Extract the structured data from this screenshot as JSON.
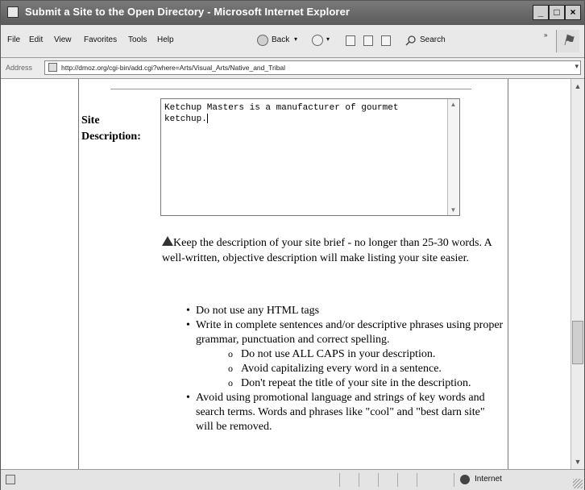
{
  "window": {
    "title": "Submit a Site to the Open Directory - Microsoft Internet Explorer",
    "controls": {
      "minimize": "_",
      "maximize": "□",
      "close": "×"
    }
  },
  "menu": [
    "File",
    "Edit",
    "View",
    "Favorites",
    "Tools",
    "Help"
  ],
  "toolbar": {
    "back_label": "Back",
    "search_label": "Search"
  },
  "address": {
    "label": "Address",
    "url": "http://dmoz.org/cgi-bin/add.cgi?where=Arts/Visual_Arts/Native_and_Tribal"
  },
  "form": {
    "description_label_line1": "Site",
    "description_label_line2": "Description:",
    "description_value": "Ketchup Masters is a manufacturer of gourmet ketchup."
  },
  "guidelines": {
    "intro": "Keep the description of your site brief - no longer than 25-30 words.  A well-written, objective description will make listing your site easier.",
    "tips": [
      "Do not use any HTML tags",
      "Write in complete sentences and/or descriptive phrases using proper grammar, punctuation and correct spelling.",
      "Avoid using promotional language and strings of key words and search terms. Words and phrases like \"cool\" and \"best darn site\" will be removed."
    ],
    "subtips": [
      "Do not use ALL CAPS in your description.",
      "Avoid capitalizing every word in a sentence.",
      "Don't repeat the title of your site in the description."
    ]
  },
  "status": {
    "zone": "Internet"
  }
}
